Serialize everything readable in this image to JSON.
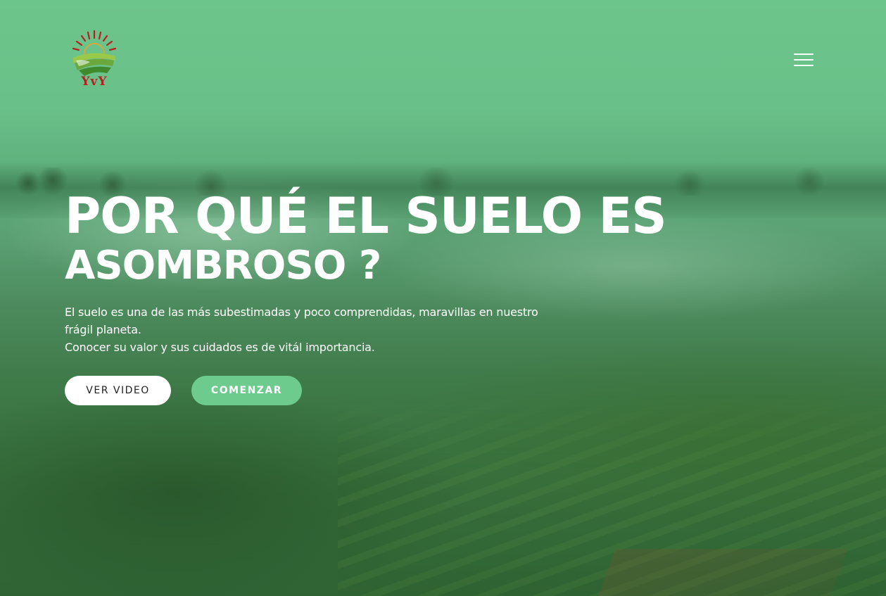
{
  "brand": {
    "logo_text": "YvY",
    "logo_icon": "sun-over-fields-logo"
  },
  "nav": {
    "menu_icon": "hamburger-menu-icon"
  },
  "hero": {
    "title_line1": "POR QUÉ EL SUELO ES",
    "title_line2": "ASOMBROSO ?",
    "description_line1": "El suelo es una de las más subestimadas y poco comprendidas, maravillas en nuestro frágil planeta.",
    "description_line2": "Conocer su valor y sus cuidados es de vitál importancia.",
    "watch_video_label": "VER VIDEO",
    "start_label": "COMENZAR"
  },
  "colors": {
    "accent_green": "#6dcb8e",
    "logo_red": "#b22222",
    "text_white": "#ffffff"
  }
}
